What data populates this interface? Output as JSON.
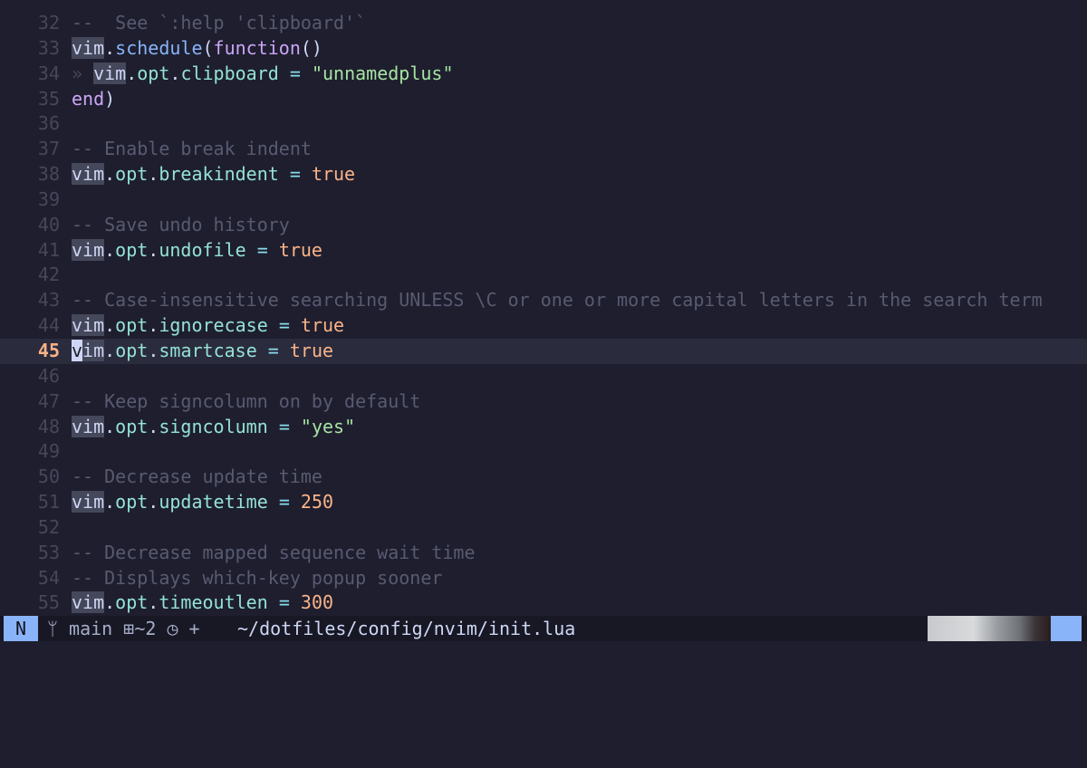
{
  "editor": {
    "current_line": 45,
    "lines": [
      {
        "num": 32,
        "tokens": [
          [
            "tok-comment",
            "--  See `:help 'clipboard'`"
          ]
        ]
      },
      {
        "num": 33,
        "tokens": [
          [
            "tok-vim",
            "vim"
          ],
          [
            "tok-punct",
            "."
          ],
          [
            "tok-fn",
            "schedule"
          ],
          [
            "tok-punct",
            "("
          ],
          [
            "tok-kw",
            "function"
          ],
          [
            "tok-punct",
            "()"
          ]
        ]
      },
      {
        "num": 34,
        "tokens": [
          [
            "tok-indent",
            "» "
          ],
          [
            "tok-vim",
            "vim"
          ],
          [
            "tok-punct",
            "."
          ],
          [
            "tok-field",
            "opt"
          ],
          [
            "tok-punct",
            "."
          ],
          [
            "tok-field",
            "clipboard"
          ],
          [
            "tok-punct",
            " "
          ],
          [
            "tok-op",
            "="
          ],
          [
            "tok-punct",
            " "
          ],
          [
            "tok-str",
            "\"unnamedplus\""
          ]
        ]
      },
      {
        "num": 35,
        "tokens": [
          [
            "tok-kw",
            "end"
          ],
          [
            "tok-punct",
            ")"
          ]
        ]
      },
      {
        "num": 36,
        "tokens": []
      },
      {
        "num": 37,
        "tokens": [
          [
            "tok-comment",
            "-- Enable break indent"
          ]
        ]
      },
      {
        "num": 38,
        "tokens": [
          [
            "tok-vim",
            "vim"
          ],
          [
            "tok-punct",
            "."
          ],
          [
            "tok-field",
            "opt"
          ],
          [
            "tok-punct",
            "."
          ],
          [
            "tok-field",
            "breakindent"
          ],
          [
            "tok-punct",
            " "
          ],
          [
            "tok-op",
            "="
          ],
          [
            "tok-punct",
            " "
          ],
          [
            "tok-bool",
            "true"
          ]
        ]
      },
      {
        "num": 39,
        "tokens": []
      },
      {
        "num": 40,
        "tokens": [
          [
            "tok-comment",
            "-- Save undo history"
          ]
        ]
      },
      {
        "num": 41,
        "tokens": [
          [
            "tok-vim",
            "vim"
          ],
          [
            "tok-punct",
            "."
          ],
          [
            "tok-field",
            "opt"
          ],
          [
            "tok-punct",
            "."
          ],
          [
            "tok-field",
            "undofile"
          ],
          [
            "tok-punct",
            " "
          ],
          [
            "tok-op",
            "="
          ],
          [
            "tok-punct",
            " "
          ],
          [
            "tok-bool",
            "true"
          ]
        ]
      },
      {
        "num": 42,
        "tokens": []
      },
      {
        "num": 43,
        "tokens": [
          [
            "tok-comment",
            "-- Case-insensitive searching UNLESS \\C or one or more capital letters in the search term"
          ]
        ]
      },
      {
        "num": 44,
        "tokens": [
          [
            "tok-vim",
            "vim"
          ],
          [
            "tok-punct",
            "."
          ],
          [
            "tok-field",
            "opt"
          ],
          [
            "tok-punct",
            "."
          ],
          [
            "tok-field",
            "ignorecase"
          ],
          [
            "tok-punct",
            " "
          ],
          [
            "tok-op",
            "="
          ],
          [
            "tok-punct",
            " "
          ],
          [
            "tok-bool",
            "true"
          ]
        ]
      },
      {
        "num": 45,
        "tokens": [
          [
            "cursor",
            "v"
          ],
          [
            "tok-vim",
            "im"
          ],
          [
            "tok-punct",
            "."
          ],
          [
            "tok-field",
            "opt"
          ],
          [
            "tok-punct",
            "."
          ],
          [
            "tok-field",
            "smartcase"
          ],
          [
            "tok-punct",
            " "
          ],
          [
            "tok-op",
            "="
          ],
          [
            "tok-punct",
            " "
          ],
          [
            "tok-bool",
            "true"
          ]
        ]
      },
      {
        "num": 46,
        "tokens": []
      },
      {
        "num": 47,
        "tokens": [
          [
            "tok-comment",
            "-- Keep signcolumn on by default"
          ]
        ]
      },
      {
        "num": 48,
        "tokens": [
          [
            "tok-vim",
            "vim"
          ],
          [
            "tok-punct",
            "."
          ],
          [
            "tok-field",
            "opt"
          ],
          [
            "tok-punct",
            "."
          ],
          [
            "tok-field",
            "signcolumn"
          ],
          [
            "tok-punct",
            " "
          ],
          [
            "tok-op",
            "="
          ],
          [
            "tok-punct",
            " "
          ],
          [
            "tok-str",
            "\"yes\""
          ]
        ]
      },
      {
        "num": 49,
        "tokens": []
      },
      {
        "num": 50,
        "tokens": [
          [
            "tok-comment",
            "-- Decrease update time"
          ]
        ]
      },
      {
        "num": 51,
        "tokens": [
          [
            "tok-vim",
            "vim"
          ],
          [
            "tok-punct",
            "."
          ],
          [
            "tok-field",
            "opt"
          ],
          [
            "tok-punct",
            "."
          ],
          [
            "tok-field",
            "updatetime"
          ],
          [
            "tok-punct",
            " "
          ],
          [
            "tok-op",
            "="
          ],
          [
            "tok-punct",
            " "
          ],
          [
            "tok-num",
            "250"
          ]
        ]
      },
      {
        "num": 52,
        "tokens": []
      },
      {
        "num": 53,
        "tokens": [
          [
            "tok-comment",
            "-- Decrease mapped sequence wait time"
          ]
        ]
      },
      {
        "num": 54,
        "tokens": [
          [
            "tok-comment",
            "-- Displays which-key popup sooner"
          ]
        ]
      },
      {
        "num": 55,
        "tokens": [
          [
            "tok-vim",
            "vim"
          ],
          [
            "tok-punct",
            "."
          ],
          [
            "tok-field",
            "opt"
          ],
          [
            "tok-punct",
            "."
          ],
          [
            "tok-field",
            "timeoutlen"
          ],
          [
            "tok-punct",
            " "
          ],
          [
            "tok-op",
            "="
          ],
          [
            "tok-punct",
            " "
          ],
          [
            "tok-num",
            "300"
          ]
        ]
      }
    ]
  },
  "statusline": {
    "mode": "N",
    "branch_icon": "git-branch-icon",
    "branch": "main",
    "diff_icon": "diff-modified-icon",
    "diff": "~2",
    "status_icon": "clock-icon",
    "status": "+",
    "filepath": "~/dotfiles/config/nvim/init.lua"
  },
  "colors": {
    "background": "#1e1e2e",
    "statusline_bg": "#181825",
    "mode_bg": "#89b4fa",
    "current_line_number": "#fab387",
    "comment": "#585b70",
    "string": "#a6e3a1",
    "boolean_number": "#fab387",
    "keyword": "#cba6f7",
    "field": "#94e2d5"
  }
}
